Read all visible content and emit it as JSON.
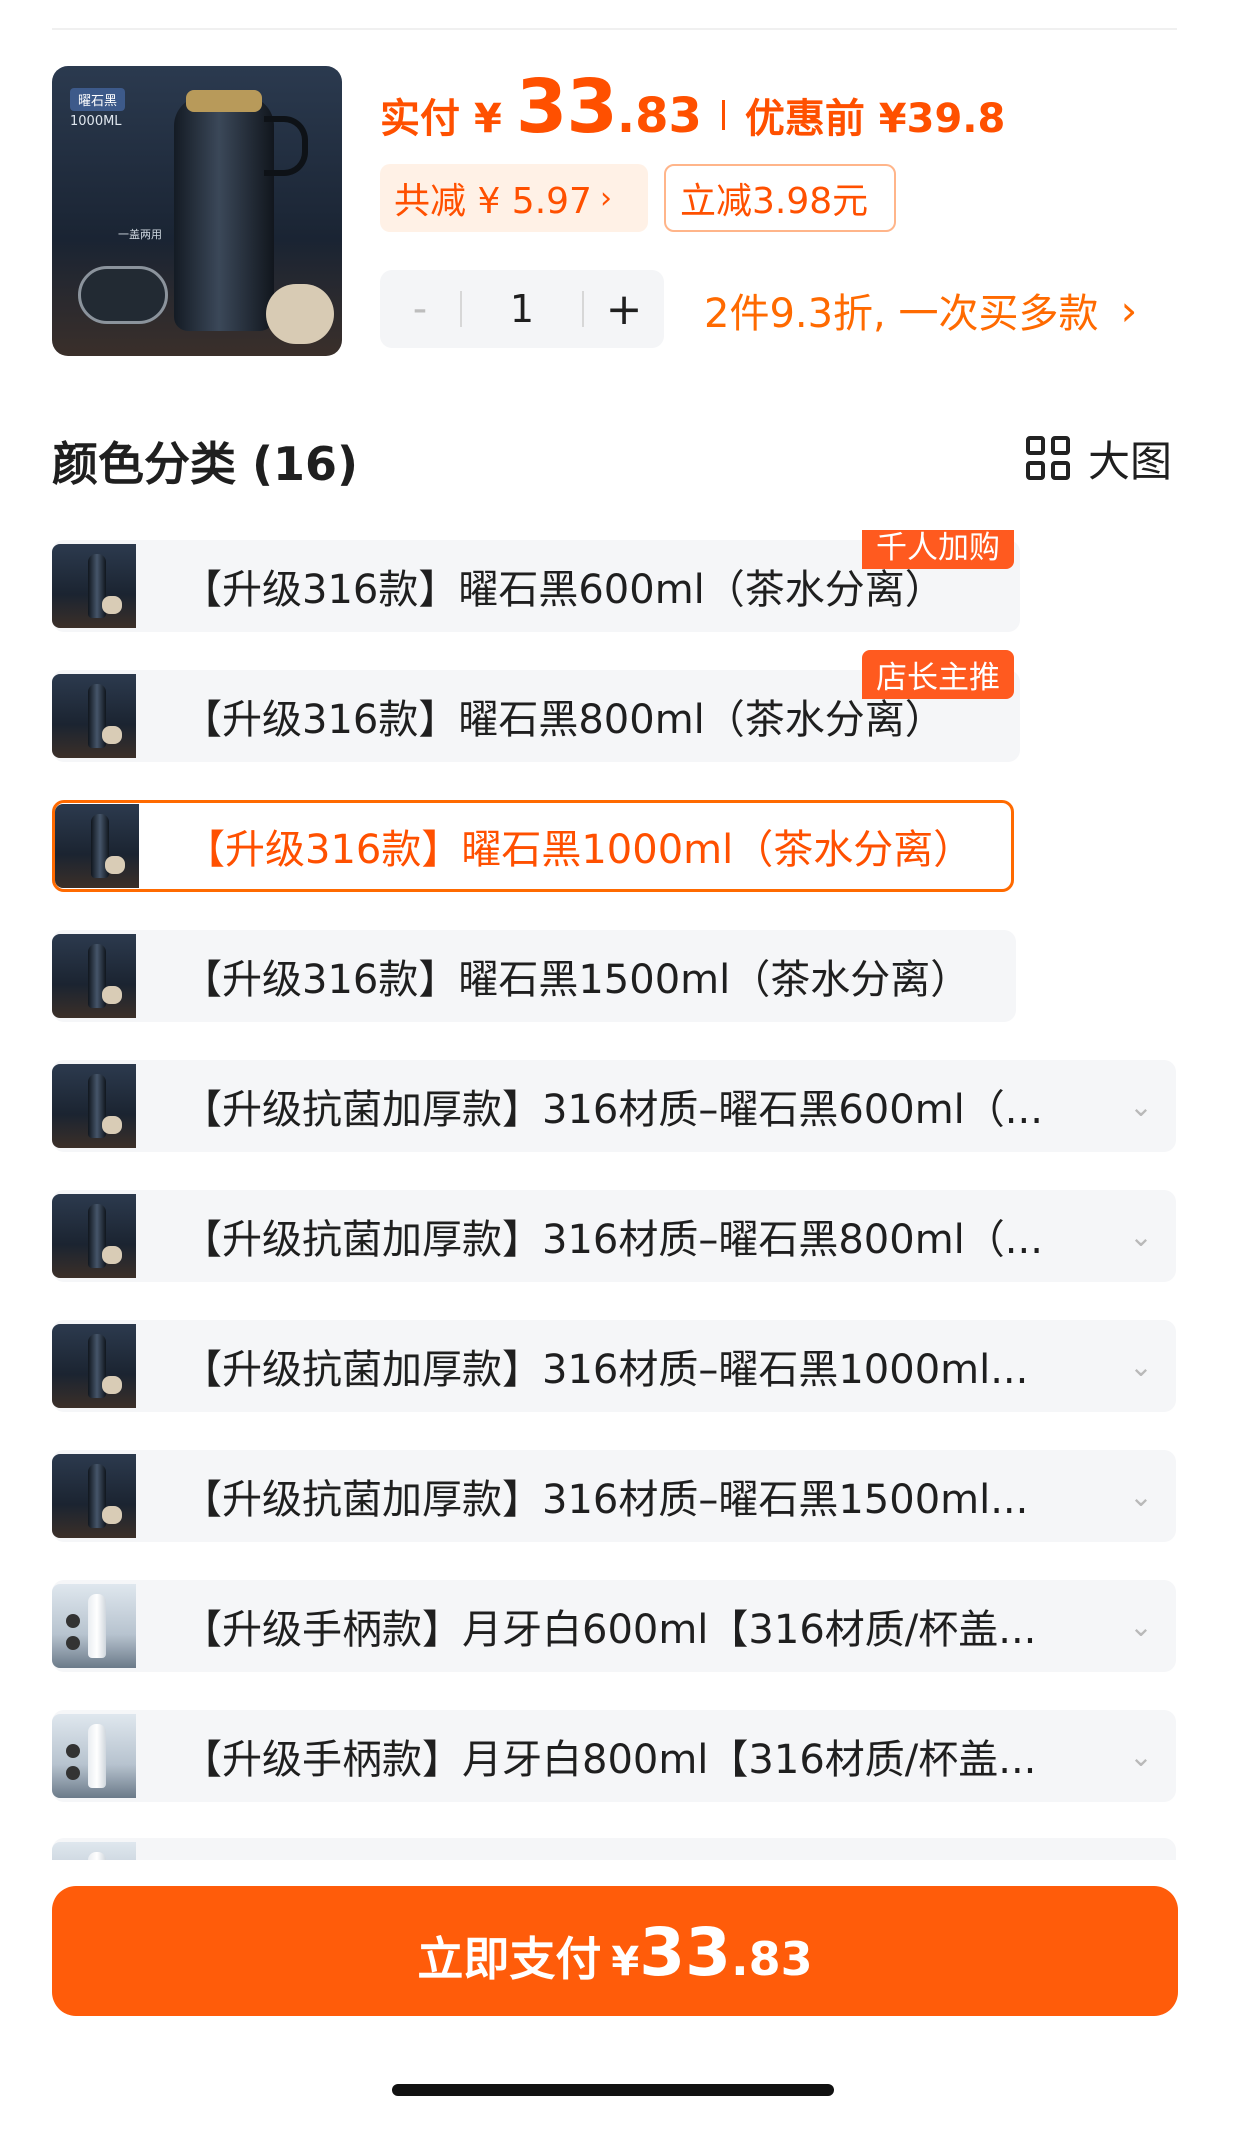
{
  "header": {
    "paid_label": "实付",
    "currency": "¥",
    "price_int": "33",
    "price_dec": ".83",
    "before_label": "优惠前 ¥39.8",
    "total_discount": "共减 ¥ 5.97",
    "direct_discount": "立减3.98元",
    "thumb_tag": "曜石黑",
    "thumb_caption": "1000ML",
    "thumb_sub": "一盖两用"
  },
  "quantity": {
    "minus": "-",
    "value": "1",
    "plus": "+"
  },
  "promo": {
    "text": "2件9.3折, 一次买多款",
    "chevron": "›"
  },
  "section": {
    "title": "颜色分类 (16)",
    "big_view": "大图"
  },
  "options": [
    {
      "label": "【升级316款】曜石黑600ml（茶水分离）",
      "badge": "千人加购"
    },
    {
      "label": "【升级316款】曜石黑800ml（茶水分离）",
      "badge": "店长主推"
    },
    {
      "label": "【升级316款】曜石黑1000ml（茶水分离）",
      "selected": true
    },
    {
      "label": "【升级316款】曜石黑1500ml（茶水分离）"
    },
    {
      "label": "【升级抗菌加厚款】316材质–曜石黑600ml（..."
    },
    {
      "label": "【升级抗菌加厚款】316材质–曜石黑800ml（..."
    },
    {
      "label": "【升级抗菌加厚款】316材质–曜石黑1000ml..."
    },
    {
      "label": "【升级抗菌加厚款】316材质–曜石黑1500ml..."
    },
    {
      "label": "【升级手柄款】月牙白600ml【316材质/杯盖..."
    },
    {
      "label": "【升级手柄款】月牙白800ml【316材质/杯盖..."
    }
  ],
  "pay_button": {
    "label": "立即支付",
    "currency": "¥",
    "price_int": "33",
    "price_dec": ".83"
  },
  "colors": {
    "accent": "#ff5000",
    "button": "#ff5c0a",
    "badge": "#ff5a1f",
    "chip_bg": "#fff1e6",
    "option_bg": "#f5f6f8"
  },
  "icons": [
    "grid-icon",
    "chevron-down-icon",
    "chevron-right-icon"
  ]
}
